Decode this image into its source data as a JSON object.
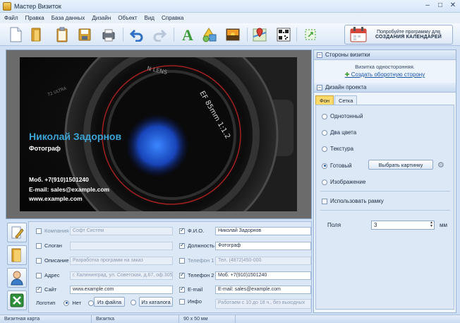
{
  "window": {
    "title": "Мастер Визиток"
  },
  "menu": [
    "Файл",
    "Правка",
    "База данных",
    "Дизайн",
    "Объект",
    "Вид",
    "Справка"
  ],
  "toolbar": {
    "promo_line1": "Попробуйте программу для",
    "promo_line2": "СОЗДАНИЯ КАЛЕНДАРЕЙ"
  },
  "card": {
    "name": "Николай Задорнов",
    "role": "Фотограф",
    "phone": "Моб. +7(910)1501240",
    "email": "E-mail: sales@example.com",
    "site": "www.example.com"
  },
  "side": {
    "sides_header": "Стороны визитки",
    "sides_note": "Визитка односторонняя.",
    "sides_link": "Создать оборотную сторону",
    "design_header": "Дизайн проекта",
    "tabs": [
      "Фон",
      "Сетка"
    ],
    "options": [
      "Однотонный",
      "Два цвета",
      "Текстура",
      "Готовый",
      "Изображение"
    ],
    "selected_option": "Готовый",
    "choose_picture": "Выбрать картинку",
    "use_frame": "Использовать рамку",
    "margins_label": "Поля",
    "margins_value": "3",
    "margins_unit": "мм"
  },
  "form": {
    "left": [
      {
        "label": "Компания",
        "checked": false,
        "value": "Софт Систем"
      },
      {
        "label": "Слоган",
        "checked": false,
        "value": ""
      },
      {
        "label": "Описание",
        "checked": false,
        "value": "Разработка программ на заказ"
      },
      {
        "label": "Адрес",
        "checked": false,
        "value": "г. Калининград, ул. Советская, д.67, оф.305"
      },
      {
        "label": "Сайт",
        "checked": true,
        "value": "www.example.com"
      }
    ],
    "right": [
      {
        "label": "Ф.И.О.",
        "checked": true,
        "value": "Николай Задорнов"
      },
      {
        "label": "Должность",
        "checked": true,
        "value": "Фотограф"
      },
      {
        "label": "Телефон 1",
        "checked": false,
        "value": "Тел. (4872)450-000"
      },
      {
        "label": "Телефон 2",
        "checked": true,
        "value": "Моб. +7(910)1501240"
      },
      {
        "label": "E-mail",
        "checked": true,
        "value": "E-mail: sales@example.com"
      },
      {
        "label": "Инфо",
        "checked": false,
        "value": "Работаем с 10 до 18 ч., без выходных"
      }
    ],
    "logo_label": "Логотип",
    "logo_none": "Нет",
    "logo_from_file": "Из файла",
    "logo_from_catalog": "Из каталога"
  },
  "status": [
    "Визитная карта",
    "Визитка",
    "90 x 50 мм"
  ],
  "colors": {
    "accent_name": "#3da4d6",
    "tab_active": "#ffd96a",
    "link": "#1753a8"
  }
}
